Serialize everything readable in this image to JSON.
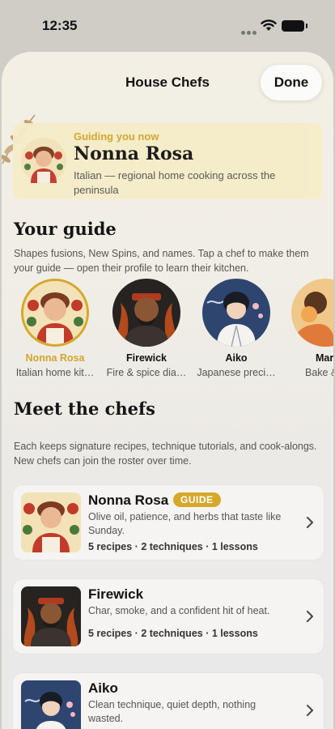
{
  "status_bar": {
    "time": "12:35"
  },
  "nav": {
    "title": "House Chefs",
    "done_label": "Done"
  },
  "current_guide": {
    "eyebrow": "Guiding you now",
    "name": "Nonna Rosa",
    "description": "Italian — regional home cooking across the peninsula"
  },
  "your_guide": {
    "title": "Your guide",
    "description": "Shapes fusions, New Spins, and names. Tap a chef to make them your guide — open their profile to learn their kitchen.",
    "chefs": [
      {
        "name": "Nonna Rosa",
        "subtitle": "Italian home kit…",
        "active": true
      },
      {
        "name": "Firewick",
        "subtitle": "Fire & spice dia…",
        "active": false
      },
      {
        "name": "Aiko",
        "subtitle": "Japanese preci…",
        "active": false
      },
      {
        "name": "Mar",
        "subtitle": "Bake &",
        "active": false
      }
    ]
  },
  "meet": {
    "title": "Meet the chefs",
    "description": "Each keeps signature recipes, technique tutorials, and cook-alongs. New chefs can join the roster over time.",
    "cards": [
      {
        "name": "Nonna Rosa",
        "badge": "GUIDE",
        "tagline": "Olive oil, patience, and herbs that taste like Sunday.",
        "stats": "5 recipes · 2 techniques · 1 lessons"
      },
      {
        "name": "Firewick",
        "tagline": "Char, smoke, and a confident hit of heat.",
        "stats": "5 recipes · 2 techniques · 1 lessons"
      },
      {
        "name": "Aiko",
        "tagline": "Clean technique, quiet depth, nothing wasted."
      }
    ]
  },
  "colors": {
    "accent": "#d6a82a",
    "accent_text": "#d2a52a",
    "banner": "#f6ecc8"
  }
}
